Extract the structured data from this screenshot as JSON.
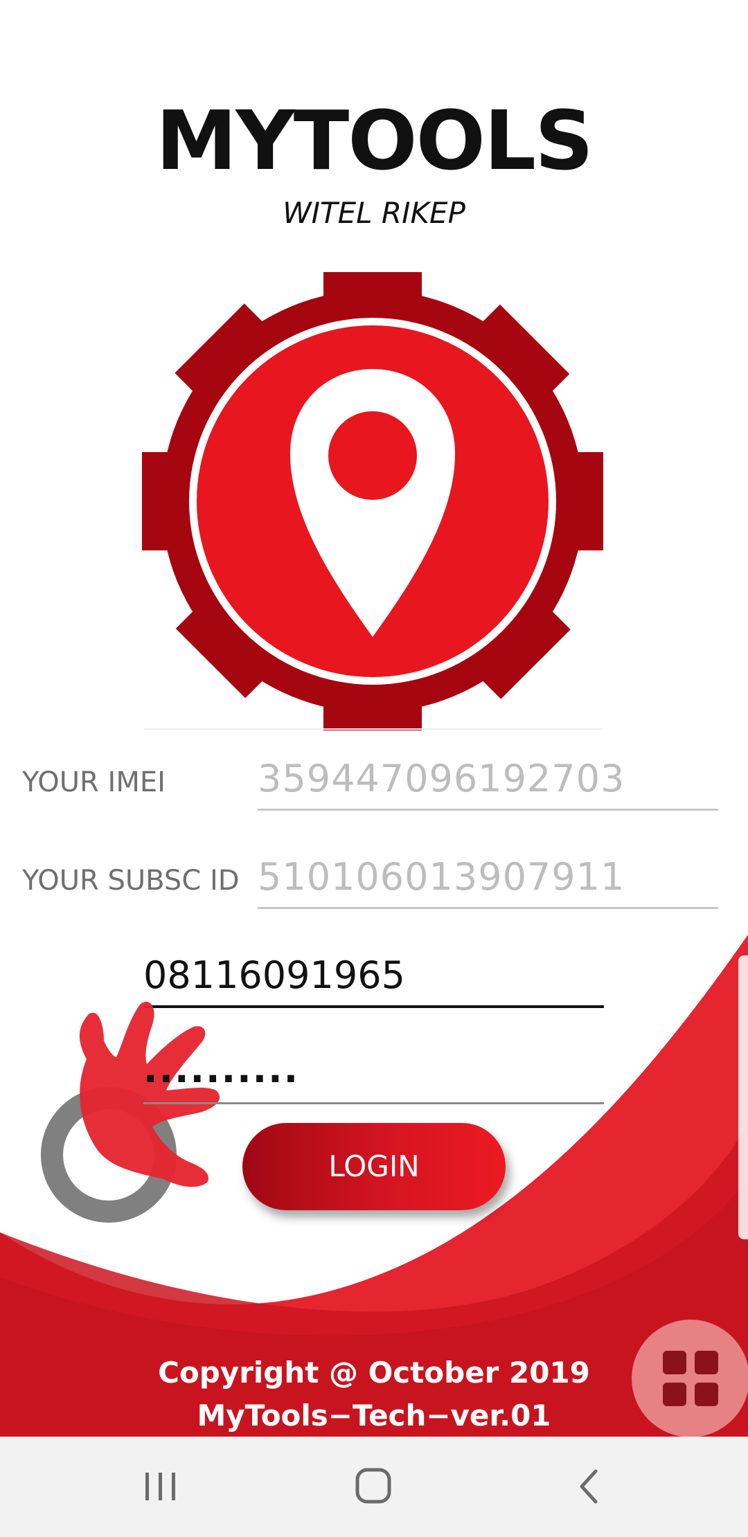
{
  "app": {
    "title": "MYTOOLS",
    "subtitle": "WITEL RIKEP"
  },
  "form": {
    "imei_label": "YOUR IMEI",
    "imei_value": "359447096192703",
    "subsc_label": "YOUR SUBSC ID",
    "subsc_value": "510106013907911",
    "phone_value": "08116091965",
    "password_value": "..........",
    "login_label": "LOGIN"
  },
  "footer": {
    "copyright_line1": "Copyright @ October 2019",
    "copyright_line2": "MyTools−Tech−ver.01"
  },
  "icons": {
    "logo": "gear-location-pin-logo",
    "brand": "red-hand-grey-ring-logo",
    "fab": "grid-icon",
    "nav_recents": "recent-apps-icon",
    "nav_home": "home-icon",
    "nav_back": "back-icon"
  },
  "colors": {
    "primary_red": "#e8161e",
    "dark_red": "#a6060f",
    "button_gradient_start": "#a00814",
    "button_gradient_end": "#ec1a22",
    "label_gray": "#6f6f6f",
    "value_gray": "#bdbdbd",
    "navbar_bg": "#f2f2f2"
  }
}
